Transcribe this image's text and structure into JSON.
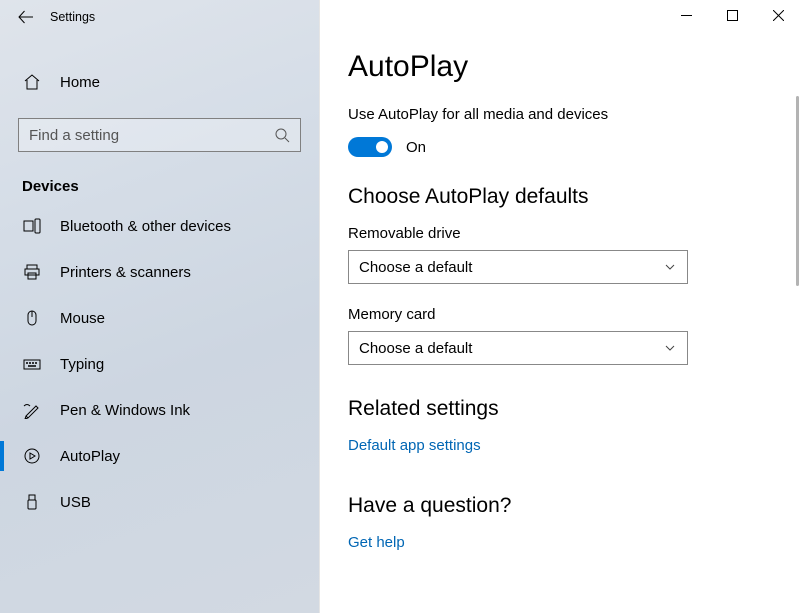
{
  "window": {
    "title": "Settings"
  },
  "sidebar": {
    "home_label": "Home",
    "search_placeholder": "Find a setting",
    "group_label": "Devices",
    "items": [
      {
        "label": "Bluetooth & other devices"
      },
      {
        "label": "Printers & scanners"
      },
      {
        "label": "Mouse"
      },
      {
        "label": "Typing"
      },
      {
        "label": "Pen & Windows Ink"
      },
      {
        "label": "AutoPlay"
      },
      {
        "label": "USB"
      }
    ]
  },
  "content": {
    "page_title": "AutoPlay",
    "toggle_label": "Use AutoPlay for all media and devices",
    "toggle_state": "On",
    "defaults_heading": "Choose AutoPlay defaults",
    "removable_label": "Removable drive",
    "removable_value": "Choose a default",
    "memory_label": "Memory card",
    "memory_value": "Choose a default",
    "related_heading": "Related settings",
    "related_link": "Default app settings",
    "question_heading": "Have a question?",
    "question_link": "Get help"
  },
  "colors": {
    "accent": "#0078d7",
    "link": "#0066b4"
  }
}
